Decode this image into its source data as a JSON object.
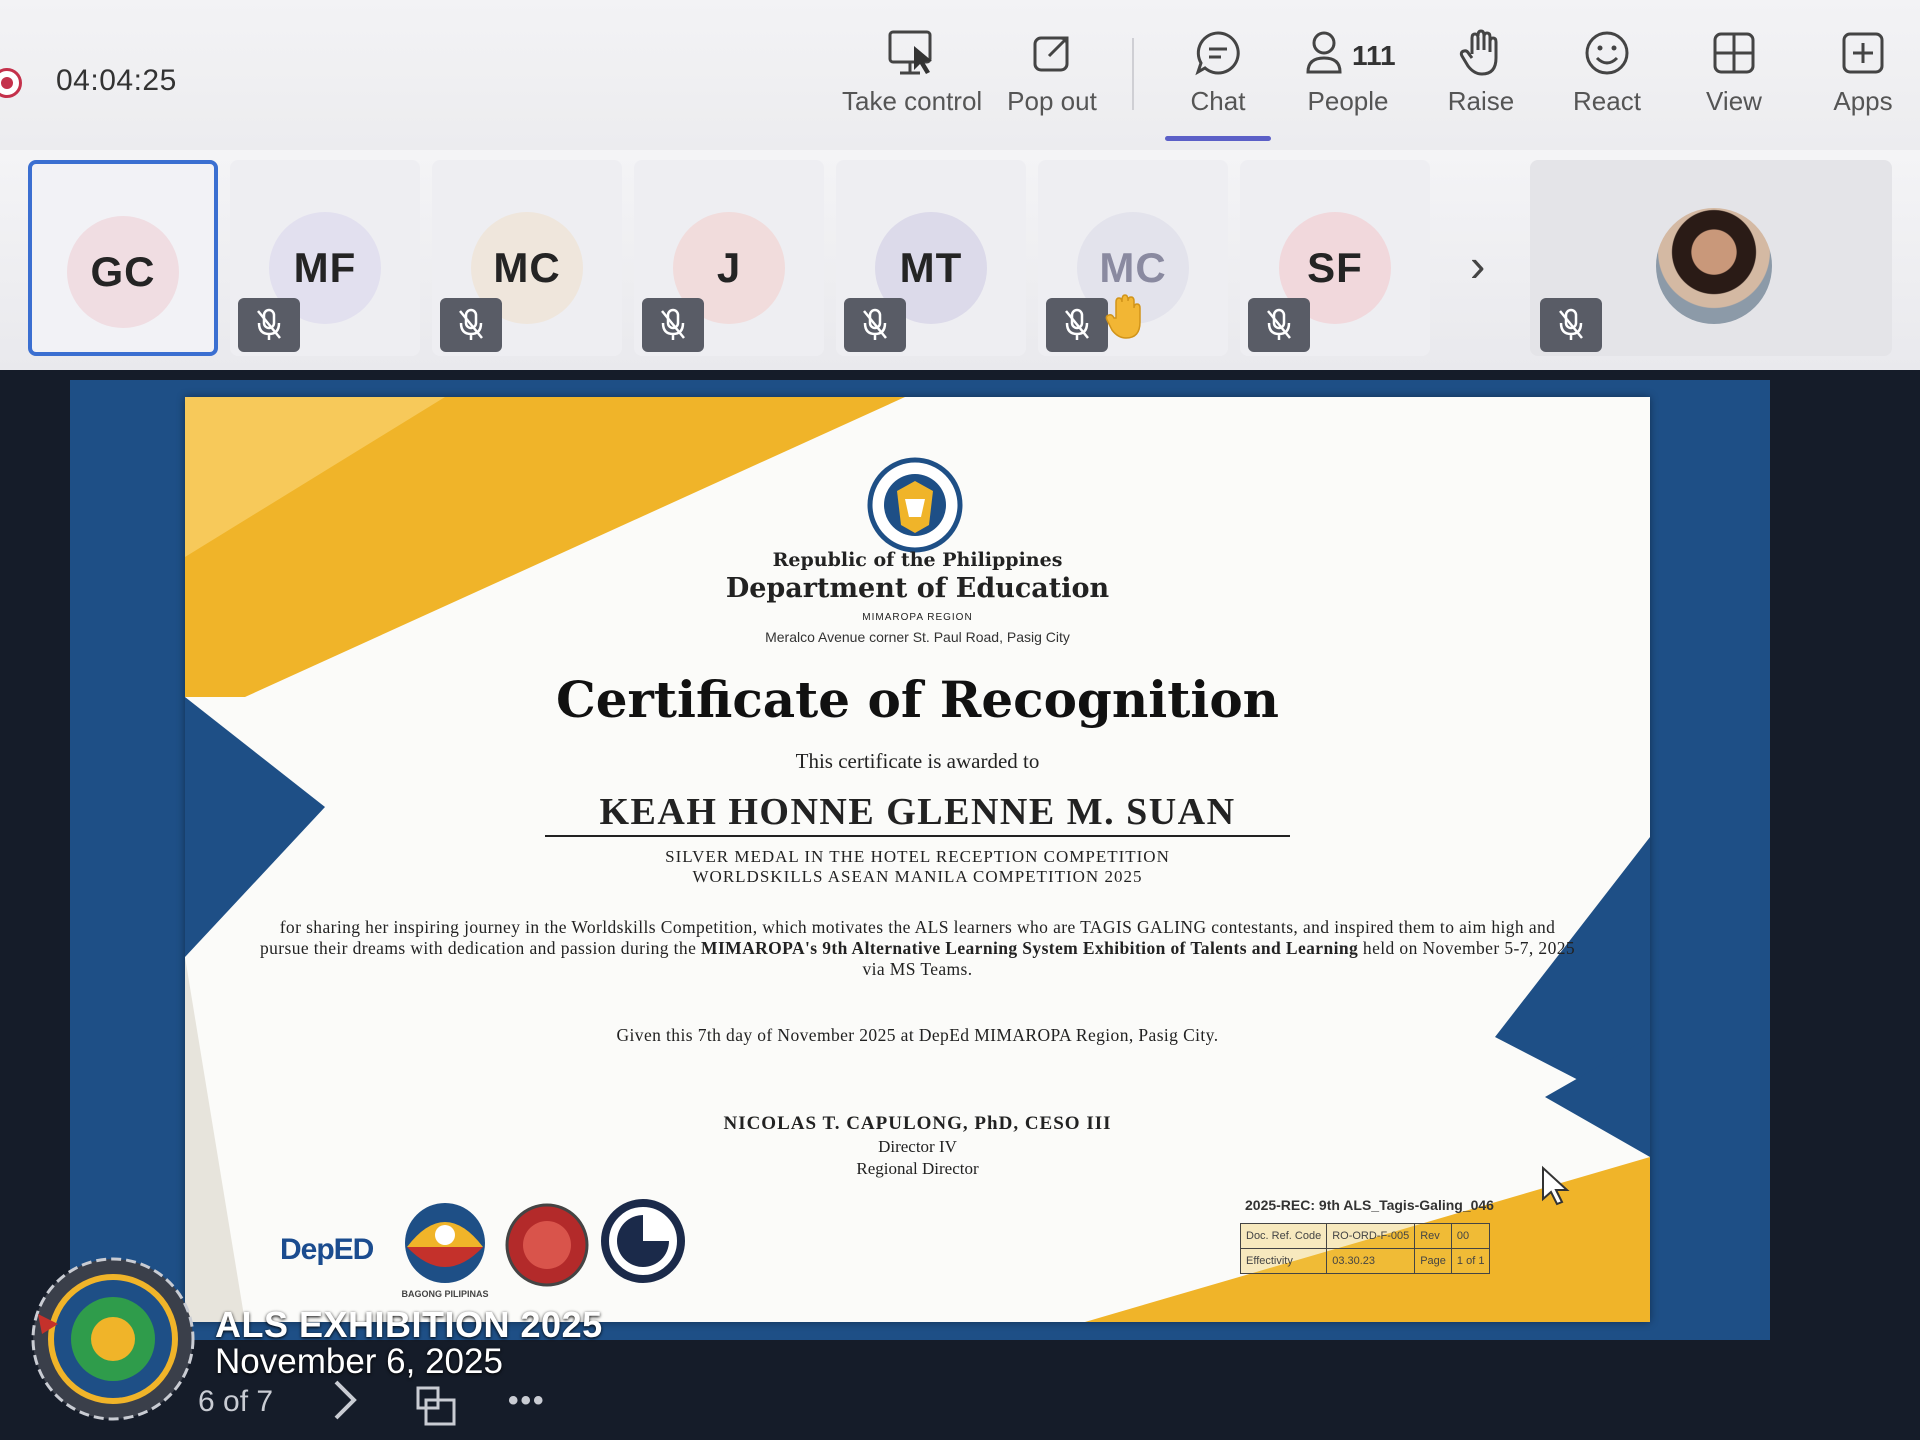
{
  "meeting": {
    "timer": "04:04:25",
    "toolbar": [
      {
        "id": "take-control",
        "label": "Take control",
        "icon": "take-control-icon"
      },
      {
        "id": "pop-out",
        "label": "Pop out",
        "icon": "pop-out-icon"
      },
      {
        "id": "chat",
        "label": "Chat",
        "icon": "chat-icon",
        "active": true
      },
      {
        "id": "people",
        "label": "People",
        "icon": "people-icon",
        "count": "111"
      },
      {
        "id": "raise",
        "label": "Raise",
        "icon": "raise-hand-icon"
      },
      {
        "id": "react",
        "label": "React",
        "icon": "react-icon"
      },
      {
        "id": "view",
        "label": "View",
        "icon": "view-icon"
      },
      {
        "id": "apps",
        "label": "Apps",
        "icon": "apps-icon"
      }
    ],
    "participants": [
      {
        "initials": "GC",
        "color": "#f0dde2",
        "muted": false,
        "active": true
      },
      {
        "initials": "MF",
        "color": "#e2e0ef",
        "muted": true
      },
      {
        "initials": "MC",
        "color": "#efe6dc",
        "muted": true
      },
      {
        "initials": "J",
        "color": "#f1dcdc",
        "muted": true
      },
      {
        "initials": "MT",
        "color": "#dcdaea",
        "muted": true
      },
      {
        "initials": "MC",
        "color": "#e3e3ec",
        "muted": true,
        "hand_raised": true
      },
      {
        "initials": "SF",
        "color": "#f1d8dc",
        "muted": true
      }
    ]
  },
  "certificate": {
    "republic": "Republic of the Philippines",
    "department": "Department of Education",
    "region": "MIMAROPA REGION",
    "address": "Meralco Avenue corner St. Paul Road, Pasig City",
    "title": "Certificate of Recognition",
    "awarded_to": "This certificate is awarded to",
    "recipient": "KEAH HONNE GLENNE M. SUAN",
    "medal_line1": "SILVER MEDAL IN THE HOTEL RECEPTION COMPETITION",
    "medal_line2": "WORLDSKILLS ASEAN MANILA COMPETITION 2025",
    "body_part1": "for sharing her inspiring journey in the Worldskills Competition, which motivates the ALS learners who are TAGIS GALING contestants, and inspired them to aim high and pursue their dreams with dedication and passion during the ",
    "body_bold": "MIMAROPA's 9th Alternative Learning System Exhibition of Talents and Learning",
    "body_part2": " held on November 5-7, 2025 via MS Teams.",
    "given": "Given this 7th day of November 2025 at DepEd MIMAROPA Region, Pasig City.",
    "signer": "NICOLAS T. CAPULONG, PhD, CESO III",
    "position1": "Director IV",
    "position2": "Regional Director",
    "doc_ref_line": "2025-REC: 9th ALS_Tagis-Galing_046",
    "ref_table": {
      "row1": [
        "Doc. Ref. Code",
        "RO-ORD-F-005",
        "Rev",
        "00"
      ],
      "row2": [
        "Effectivity",
        "03.30.23",
        "Page",
        "1 of 1"
      ]
    },
    "deped_logo": "DepED",
    "bagong_pilipinas": "BAGONG PILIPINAS"
  },
  "overlay": {
    "title": "ALS EXHIBITION 2025",
    "date": "November 6, 2025",
    "pager": "6 of 7"
  },
  "colors": {
    "accent": "#5b5fc7",
    "cert_blue": "#1e4f86",
    "cert_gold": "#f0b429",
    "record_red": "#c4314b"
  }
}
